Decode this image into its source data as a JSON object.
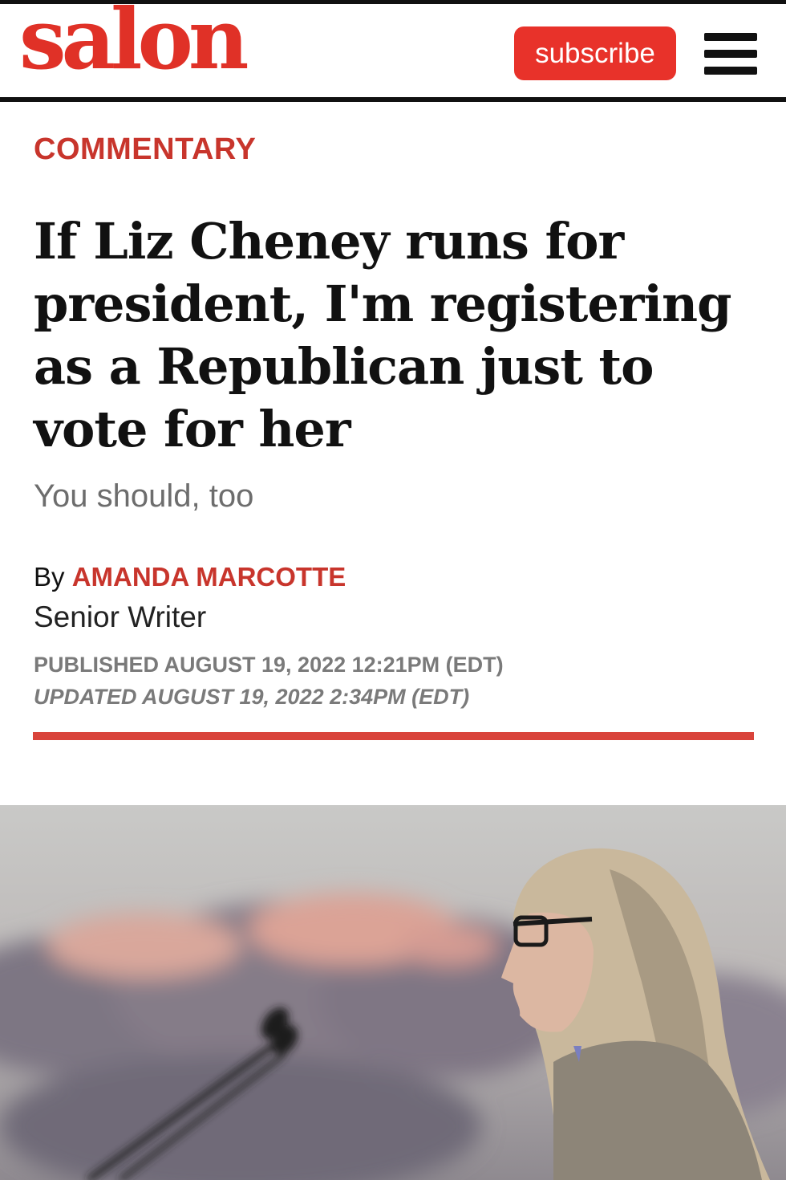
{
  "header": {
    "logo_text": "salon",
    "subscribe_label": "subscribe",
    "menu_icon": "hamburger-menu-icon",
    "brand_color": "#e03127"
  },
  "article": {
    "section": "COMMENTARY",
    "headline": "If Liz Cheney runs for president, I'm registering as a Republican just to vote for her",
    "dek": "You should, too",
    "byline_prefix": "By",
    "author": "AMANDA MARCOTTE",
    "author_role": "Senior Writer",
    "published": "PUBLISHED AUGUST 19, 2022 12:21PM (EDT)",
    "updated": "UPDATED AUGUST 19, 2022 2:34PM (EDT)",
    "accent_color": "#c8352c"
  }
}
